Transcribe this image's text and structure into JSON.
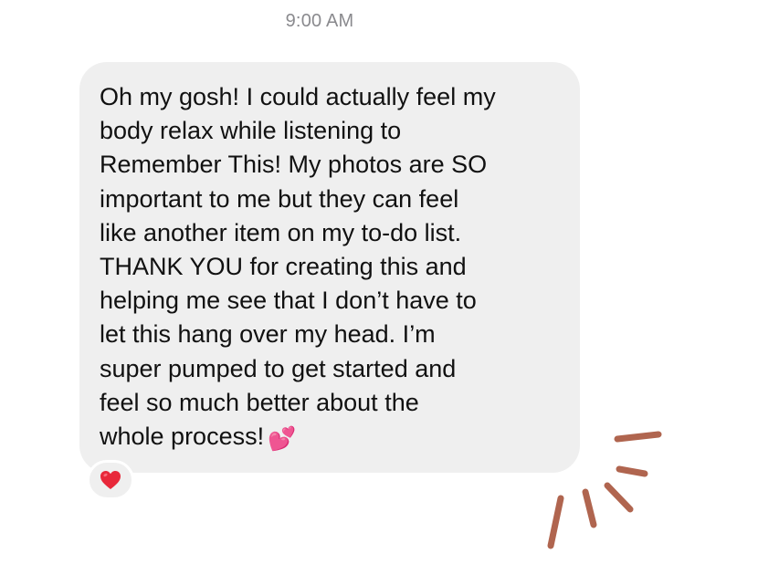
{
  "conversation": {
    "timestamp": "9:00 AM"
  },
  "message": {
    "text": "Oh my gosh! I could actually feel my\nbody relax while listening to\nRemember This! My photos are SO\nimportant to me but they can feel\nlike another item on my to-do list.\nTHANK YOU for creating this and\nhelping me see that I don’t have to\nlet this hang over my head. I’m\nsuper pumped to get started and\nfeel so much better about the\nwhole process!",
    "emoji": "💕"
  },
  "reaction": {
    "icon": "red-heart-icon",
    "color": "#e8283a"
  },
  "decoration": {
    "icon": "hand-drawn-sparkle-lines",
    "color": "#b0654f"
  },
  "colors": {
    "bubble": "#efefef",
    "timestamp": "#8a8a8e",
    "text": "#111111"
  }
}
